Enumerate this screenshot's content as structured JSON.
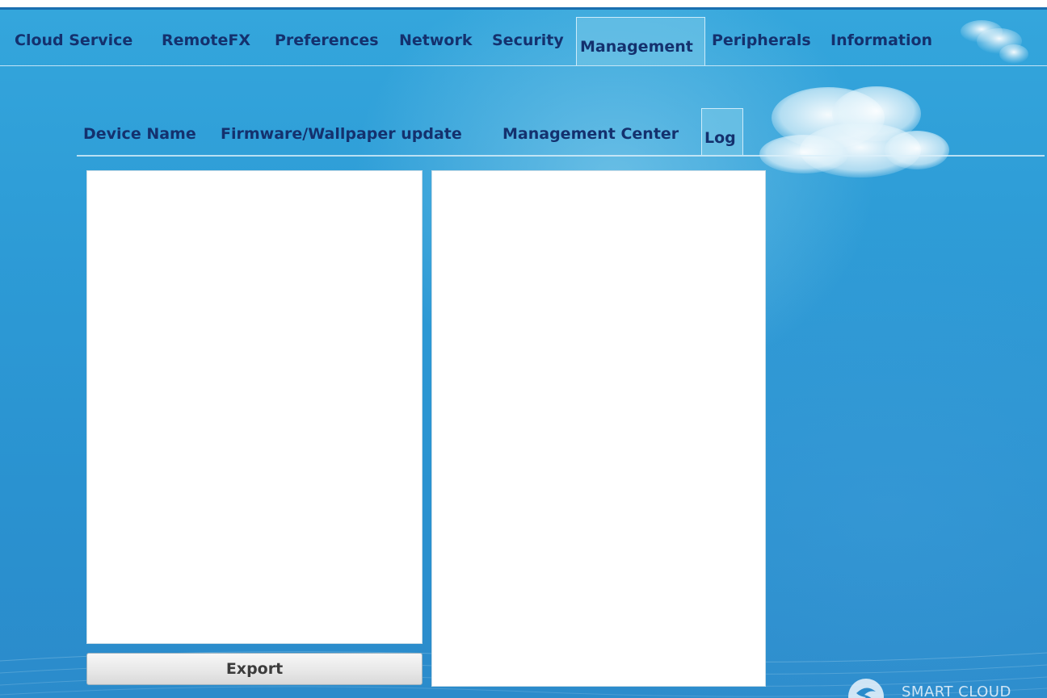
{
  "main_tabs": [
    {
      "label": "Cloud Service"
    },
    {
      "label": "RemoteFX"
    },
    {
      "label": "Preferences"
    },
    {
      "label": "Network"
    },
    {
      "label": "Security"
    },
    {
      "label": "Management"
    },
    {
      "label": "Peripherals"
    },
    {
      "label": "Information"
    }
  ],
  "active_main_tab": "Management",
  "sub_tabs": [
    {
      "label": "Device Name"
    },
    {
      "label": "Firmware/Wallpaper update"
    },
    {
      "label": "Management Center"
    },
    {
      "label": "Log"
    }
  ],
  "active_sub_tab": "Log",
  "log": {
    "export_label": "Export"
  },
  "brand": {
    "text": "SMART CLOUD",
    "logo_icon": "smart-cloud-logo-icon"
  },
  "colors": {
    "background": "#2d9bd6",
    "tab_text": "#14316e",
    "panel": "#ffffff"
  }
}
